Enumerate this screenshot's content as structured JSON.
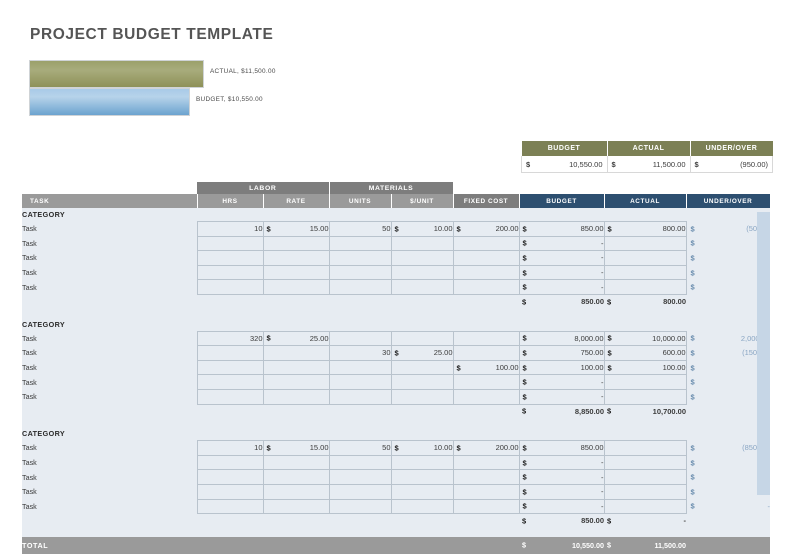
{
  "title": "PROJECT BUDGET TEMPLATE",
  "chart_data": {
    "type": "bar",
    "title": "",
    "orientation": "horizontal",
    "categories": [
      "ACTUAL",
      "BUDGET"
    ],
    "values": [
      11500.0,
      10550.0
    ],
    "value_labels": [
      "$11,500.00",
      "$10,550.00"
    ],
    "labels": [
      "ACTUAL,  $11,500.00",
      "BUDGET,  $10,550.00"
    ],
    "series": [
      {
        "name": "ACTUAL",
        "value": 11500.0,
        "label": "ACTUAL,  $11,500.00",
        "color": "#9ba06a"
      },
      {
        "name": "BUDGET",
        "value": 10550.0,
        "label": "BUDGET,  $10,550.00",
        "color": "#8cb8dd"
      }
    ],
    "xlabel": "",
    "ylabel": "",
    "grid": false,
    "legend": "right-inline"
  },
  "summary": {
    "headers": [
      "BUDGET",
      "ACTUAL",
      "UNDER/OVER"
    ],
    "budget": {
      "currency": "$",
      "amount": "10,550.00"
    },
    "actual": {
      "currency": "$",
      "amount": "11,500.00"
    },
    "under_over": {
      "currency": "$",
      "amount": "(950.00)"
    }
  },
  "grid": {
    "group_headers": {
      "labor": "LABOR",
      "materials": "MATERIALS"
    },
    "columns": {
      "task": "TASK",
      "hrs": "HRS",
      "rate": "RATE",
      "units": "UNITS",
      "sunit": "$/UNIT",
      "fixed": "FIXED COST",
      "budget": "BUDGET",
      "actual": "ACTUAL",
      "under_over": "UNDER/OVER"
    },
    "category_label": "CATEGORY",
    "task_label": "Task",
    "dash": "-",
    "currency": "$",
    "sections": [
      {
        "name": "CATEGORY",
        "rows": [
          {
            "task": "Task",
            "hrs": "10",
            "rate": "15.00",
            "units": "50",
            "sunit": "10.00",
            "fixed": "200.00",
            "budget": "850.00",
            "actual": "800.00",
            "under_over": "(50.00)"
          },
          {
            "task": "Task",
            "hrs": "",
            "rate": "",
            "units": "",
            "sunit": "",
            "fixed": "",
            "budget": "-",
            "actual": "",
            "under_over": "-"
          },
          {
            "task": "Task",
            "hrs": "",
            "rate": "",
            "units": "",
            "sunit": "",
            "fixed": "",
            "budget": "-",
            "actual": "",
            "under_over": "-"
          },
          {
            "task": "Task",
            "hrs": "",
            "rate": "",
            "units": "",
            "sunit": "",
            "fixed": "",
            "budget": "-",
            "actual": "",
            "under_over": "-"
          },
          {
            "task": "Task",
            "hrs": "",
            "rate": "",
            "units": "",
            "sunit": "",
            "fixed": "",
            "budget": "-",
            "actual": "",
            "under_over": "-"
          }
        ],
        "subtotal": {
          "budget": "850.00",
          "actual": "800.00"
        }
      },
      {
        "name": "CATEGORY",
        "rows": [
          {
            "task": "Task",
            "hrs": "320",
            "rate": "25.00",
            "units": "",
            "sunit": "",
            "fixed": "",
            "budget": "8,000.00",
            "actual": "10,000.00",
            "under_over": "2,000.00"
          },
          {
            "task": "Task",
            "hrs": "",
            "rate": "",
            "units": "30",
            "sunit": "25.00",
            "fixed": "",
            "budget": "750.00",
            "actual": "600.00",
            "under_over": "(150.00)"
          },
          {
            "task": "Task",
            "hrs": "",
            "rate": "",
            "units": "",
            "sunit": "",
            "fixed": "100.00",
            "budget": "100.00",
            "actual": "100.00",
            "under_over": "-"
          },
          {
            "task": "Task",
            "hrs": "",
            "rate": "",
            "units": "",
            "sunit": "",
            "fixed": "",
            "budget": "-",
            "actual": "",
            "under_over": "-"
          },
          {
            "task": "Task",
            "hrs": "",
            "rate": "",
            "units": "",
            "sunit": "",
            "fixed": "",
            "budget": "-",
            "actual": "",
            "under_over": "-"
          }
        ],
        "subtotal": {
          "budget": "8,850.00",
          "actual": "10,700.00"
        }
      },
      {
        "name": "CATEGORY",
        "rows": [
          {
            "task": "Task",
            "hrs": "10",
            "rate": "15.00",
            "units": "50",
            "sunit": "10.00",
            "fixed": "200.00",
            "budget": "850.00",
            "actual": "",
            "under_over": "(850.00)"
          },
          {
            "task": "Task",
            "hrs": "",
            "rate": "",
            "units": "",
            "sunit": "",
            "fixed": "",
            "budget": "-",
            "actual": "",
            "under_over": "-"
          },
          {
            "task": "Task",
            "hrs": "",
            "rate": "",
            "units": "",
            "sunit": "",
            "fixed": "",
            "budget": "-",
            "actual": "",
            "under_over": "-"
          },
          {
            "task": "Task",
            "hrs": "",
            "rate": "",
            "units": "",
            "sunit": "",
            "fixed": "",
            "budget": "-",
            "actual": "",
            "under_over": "-"
          },
          {
            "task": "Task",
            "hrs": "",
            "rate": "",
            "units": "",
            "sunit": "",
            "fixed": "",
            "budget": "-",
            "actual": "",
            "under_over": "-"
          }
        ],
        "subtotal": {
          "budget": "850.00",
          "actual": "-"
        }
      }
    ],
    "total": {
      "label": "TOTAL",
      "budget": "10,550.00",
      "actual": "11,500.00"
    }
  }
}
